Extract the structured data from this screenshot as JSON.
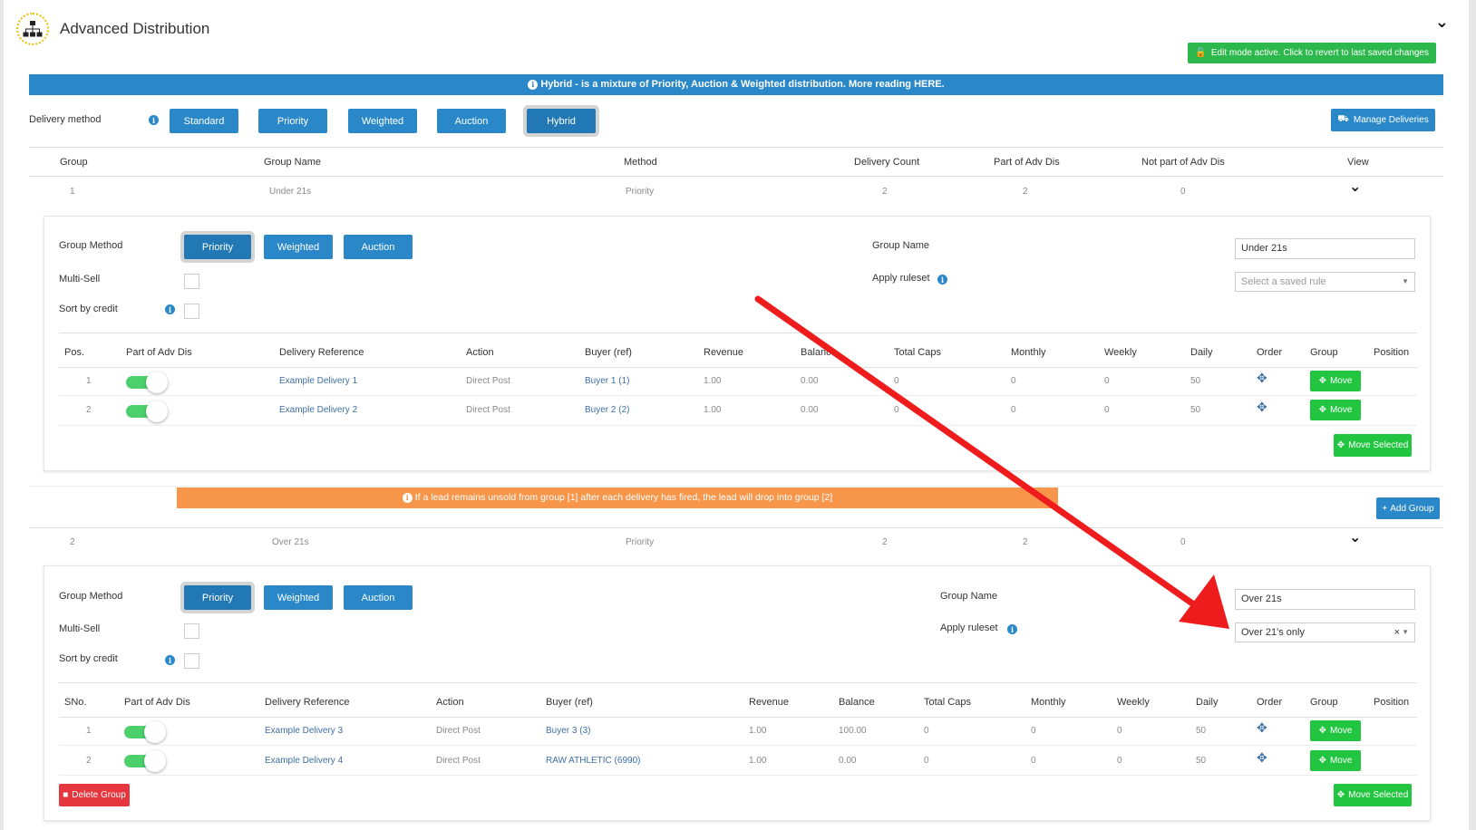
{
  "app": {
    "title": "Advanced Distribution",
    "edit_mode_label": "Edit mode active. Click to revert to last saved changes"
  },
  "info_banner": {
    "text": "Hybrid - is a mixture of Priority, Auction & Weighted distribution. More reading ",
    "link": "HERE."
  },
  "delivery_method": {
    "label": "Delivery method",
    "options": [
      "Standard",
      "Priority",
      "Weighted",
      "Auction",
      "Hybrid"
    ],
    "selected": "Hybrid",
    "manage_label": "Manage Deliveries"
  },
  "groups_table": {
    "headers": [
      "Group",
      "Group Name",
      "Method",
      "Delivery Count",
      "Part of Adv Dis",
      "Not part of Adv Dis",
      "View"
    ]
  },
  "group1": {
    "row": [
      "1",
      "Under 21s",
      "Priority",
      "2",
      "2",
      "0"
    ],
    "method_label": "Group Method",
    "methods": [
      "Priority",
      "Weighted",
      "Auction"
    ],
    "selected_method": "Priority",
    "multisell_label": "Multi-Sell",
    "sort_label": "Sort by credit",
    "group_name_label": "Group Name",
    "group_name_value": "Under 21s",
    "ruleset_label": "Apply ruleset",
    "ruleset_placeholder": "Select a saved rule",
    "headers": [
      "Pos.",
      "Part of Adv Dis",
      "Delivery Reference",
      "Action",
      "Buyer (ref)",
      "Revenue",
      "Balance",
      "Total Caps",
      "Monthly",
      "Weekly",
      "Daily",
      "Order",
      "Group",
      "Position"
    ],
    "rows": [
      {
        "pos": "1",
        "ref": "Example Delivery 1",
        "action": "Direct Post",
        "buyer": "Buyer 1 (1)",
        "revenue": "1.00",
        "balance": "0.00",
        "caps": "0",
        "monthly": "0",
        "weekly": "0",
        "daily": "50",
        "move": "Move"
      },
      {
        "pos": "2",
        "ref": "Example Delivery 2",
        "action": "Direct Post",
        "buyer": "Buyer 2 (2)",
        "revenue": "1.00",
        "balance": "0.00",
        "caps": "0",
        "monthly": "0",
        "weekly": "0",
        "daily": "50",
        "move": "Move"
      }
    ],
    "move_selected": "Move Selected"
  },
  "warning_banner": "If a lead remains unsold from group [1] after each delivery has fired, the lead will drop into group [2]",
  "add_group_label": "Add Group",
  "group2": {
    "row": [
      "2",
      "Over 21s",
      "Priority",
      "2",
      "2",
      "0"
    ],
    "method_label": "Group Method",
    "methods": [
      "Priority",
      "Weighted",
      "Auction"
    ],
    "selected_method": "Priority",
    "multisell_label": "Multi-Sell",
    "sort_label": "Sort by credit",
    "group_name_label": "Group Name",
    "group_name_value": "Over 21s",
    "ruleset_label": "Apply ruleset",
    "ruleset_value": "Over 21's only",
    "headers": [
      "SNo.",
      "Part of Adv Dis",
      "Delivery Reference",
      "Action",
      "Buyer (ref)",
      "Revenue",
      "Balance",
      "Total Caps",
      "Monthly",
      "Weekly",
      "Daily",
      "Order",
      "Group",
      "Position"
    ],
    "rows": [
      {
        "pos": "1",
        "ref": "Example Delivery 3",
        "action": "Direct Post",
        "buyer": "Buyer 3 (3)",
        "revenue": "1.00",
        "balance": "100.00",
        "caps": "0",
        "monthly": "0",
        "weekly": "0",
        "daily": "50",
        "move": "Move"
      },
      {
        "pos": "2",
        "ref": "Example Delivery 4",
        "action": "Direct Post",
        "buyer": "RAW ATHLETIC (6990)",
        "revenue": "1.00",
        "balance": "0.00",
        "caps": "0",
        "monthly": "0",
        "weekly": "0",
        "daily": "50",
        "move": "Move"
      }
    ],
    "delete_label": "Delete Group",
    "move_selected": "Move Selected"
  },
  "colors": {
    "primary": "#2a88c8",
    "success": "#22c540",
    "warning": "#f7964a",
    "danger": "#e5363d",
    "annotation_arrow": "#ee1c1c"
  }
}
